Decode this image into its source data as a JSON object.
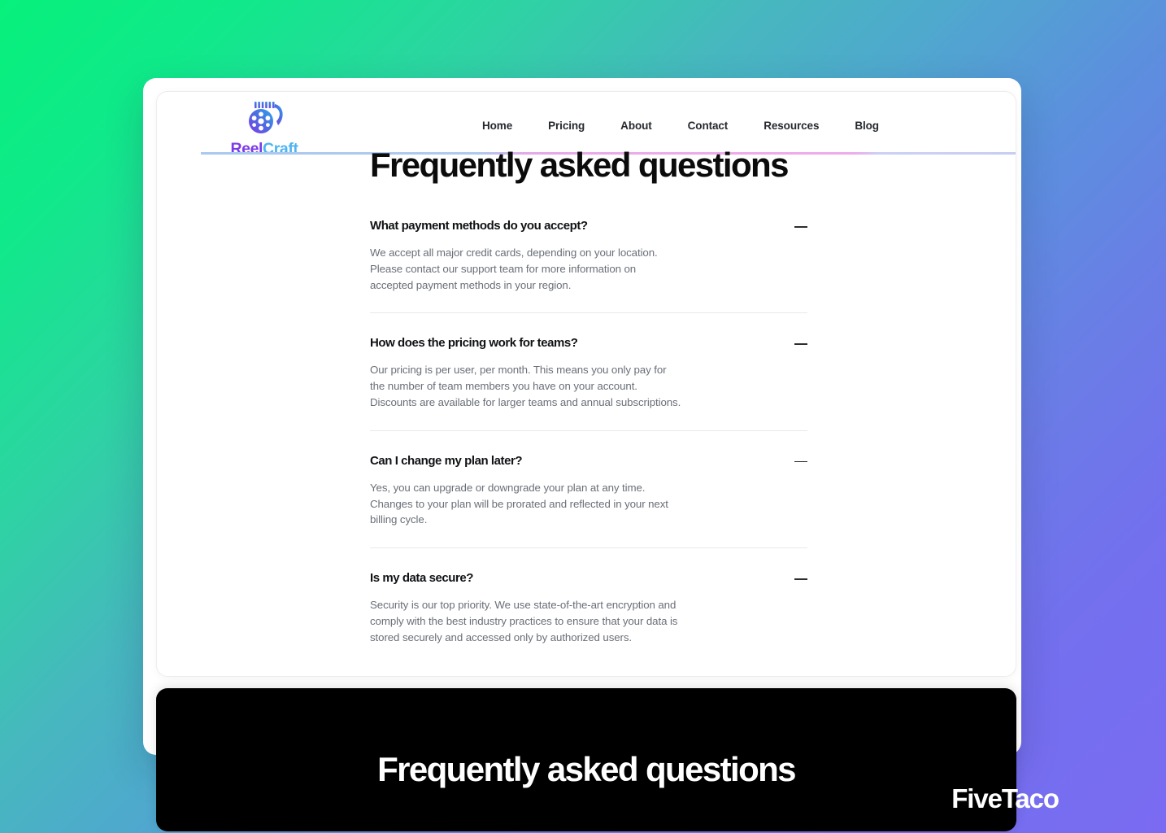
{
  "background": {
    "gradient_from": "#07F07C",
    "gradient_mid": "#4FA8CE",
    "gradient_to": "#7A6BF2"
  },
  "brand": {
    "icon": "film-reel-icon",
    "name_part1": "Reel",
    "name_part2": "Craft",
    "color_part1": "#7C3BE8",
    "color_part2": "#4FB4F0"
  },
  "nav": {
    "items": [
      {
        "label": "Home"
      },
      {
        "label": "Pricing"
      },
      {
        "label": "About"
      },
      {
        "label": "Contact"
      },
      {
        "label": "Resources"
      },
      {
        "label": "Blog"
      }
    ]
  },
  "faq": {
    "title": "Frequently asked questions",
    "toggle_icon": "minus-icon",
    "items": [
      {
        "question": "What payment methods do you accept?",
        "answer_lines": [
          "We accept all major credit cards, depending on your location.",
          "Please contact our support team for more information on",
          "accepted payment methods in your region."
        ]
      },
      {
        "question": "How does the pricing work for teams?",
        "answer_lines": [
          "Our pricing is per user, per month. This means you only pay for",
          "the number of team members you have on your account.",
          "Discounts are available for larger teams and annual subscriptions."
        ]
      },
      {
        "question": "Can I change my plan later?",
        "answer_lines": [
          "Yes, you can upgrade or downgrade your plan at any time.",
          "Changes to your plan will be prorated and reflected in your next",
          "billing cycle."
        ]
      },
      {
        "question": "Is my data secure?",
        "answer_lines": [
          "Security is our top priority. We use state-of-the-art encryption and",
          "comply with the best industry practices to ensure that your data is",
          "stored securely and accessed only by authorized users."
        ]
      }
    ]
  },
  "cta_band": {
    "heading": "Frequently asked questions",
    "background": "#000000"
  },
  "watermark": {
    "text": "FiveTaco"
  }
}
